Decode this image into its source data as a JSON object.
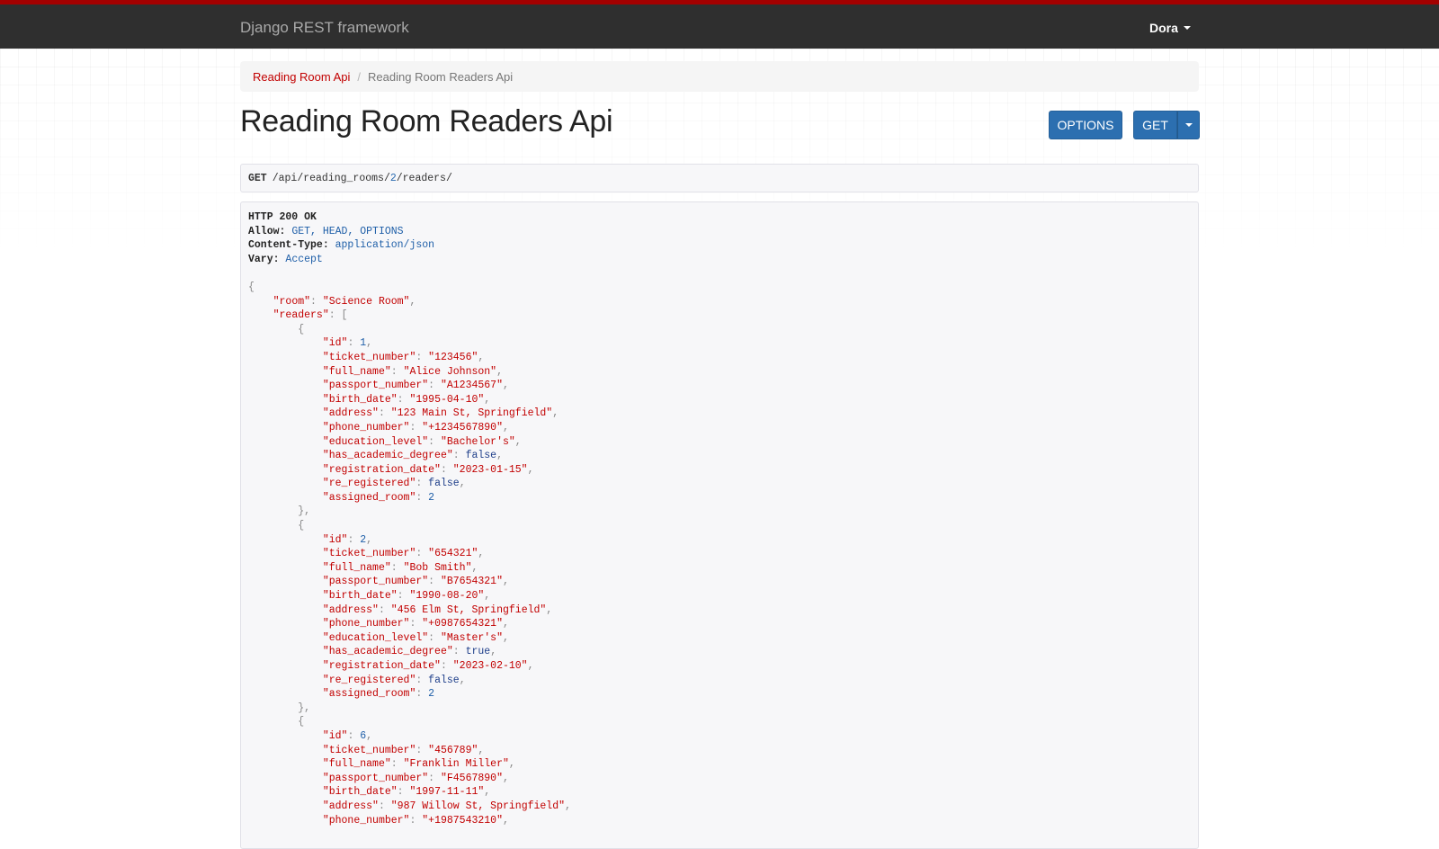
{
  "navbar": {
    "brand": "Django REST framework",
    "user": "Dora"
  },
  "breadcrumb": {
    "parent": "Reading Room Api",
    "current": "Reading Room Readers Api"
  },
  "page": {
    "title": "Reading Room Readers Api",
    "options_label": "OPTIONS",
    "get_label": "GET"
  },
  "request": {
    "method": "GET",
    "path_parts": [
      "/api/reading_rooms/",
      "2",
      "/readers/"
    ]
  },
  "response": {
    "status": "HTTP 200 OK",
    "headers": [
      {
        "name": "Allow:",
        "value": "GET, HEAD, OPTIONS"
      },
      {
        "name": "Content-Type:",
        "value": "application/json"
      },
      {
        "name": "Vary:",
        "value": "Accept"
      }
    ],
    "room": "\"Science Room\"",
    "readers": [
      {
        "id": "1",
        "ticket_number": "\"123456\"",
        "full_name": "\"Alice Johnson\"",
        "passport_number": "\"A1234567\"",
        "birth_date": "\"1995-04-10\"",
        "address": "\"123 Main St, Springfield\"",
        "phone_number": "\"+1234567890\"",
        "education_level": "\"Bachelor's\"",
        "has_academic_degree": "false",
        "registration_date": "\"2023-01-15\"",
        "re_registered": "false",
        "assigned_room": "2"
      },
      {
        "id": "2",
        "ticket_number": "\"654321\"",
        "full_name": "\"Bob Smith\"",
        "passport_number": "\"B7654321\"",
        "birth_date": "\"1990-08-20\"",
        "address": "\"456 Elm St, Springfield\"",
        "phone_number": "\"+0987654321\"",
        "education_level": "\"Master's\"",
        "has_academic_degree": "true",
        "registration_date": "\"2023-02-10\"",
        "re_registered": "false",
        "assigned_room": "2"
      },
      {
        "id": "6",
        "ticket_number": "\"456789\"",
        "full_name": "\"Franklin Miller\"",
        "passport_number": "\"F4567890\"",
        "birth_date": "\"1997-11-11\"",
        "address": "\"987 Willow St, Springfield\"",
        "phone_number": "\"+1987543210\""
      }
    ]
  },
  "colors": {
    "accent": "#a30000",
    "button": "#2c6fb0",
    "link": "#c20000",
    "navbar": "#2f2f2f"
  }
}
